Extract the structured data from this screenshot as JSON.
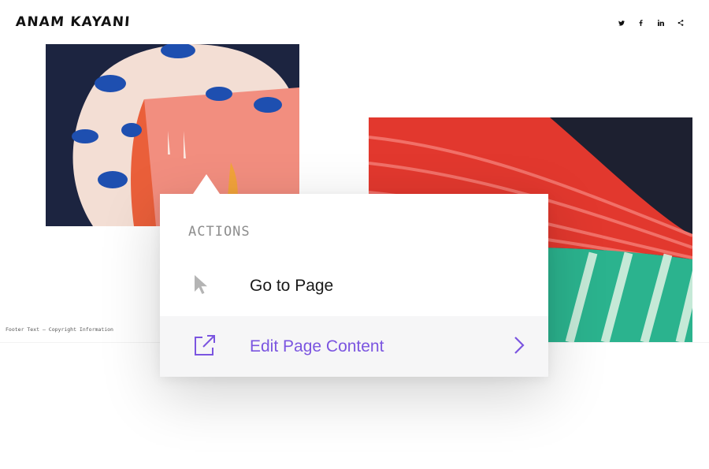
{
  "brand": {
    "name": "ANAM KAYANI"
  },
  "social": [
    {
      "icon": "twitter-icon",
      "glyph": "ὂ6"
    },
    {
      "icon": "facebook-icon",
      "glyph": "f"
    },
    {
      "icon": "linkedin-icon",
      "glyph": "in"
    },
    {
      "icon": "share-icon",
      "glyph": "<"
    }
  ],
  "footer": {
    "text": "Footer Text – Copyright Information"
  },
  "actions_menu": {
    "heading": "ACTIONS",
    "items": [
      {
        "label": "Go to Page",
        "icon": "cursor-icon"
      },
      {
        "label": "Edit Page Content",
        "icon": "external-link-icon",
        "trailing_icon": "chevron-right-icon"
      }
    ]
  },
  "colors": {
    "accent": "#7b55e0",
    "heading_gray": "#8d8d8d",
    "highlight_row": "#f6f6f7"
  }
}
